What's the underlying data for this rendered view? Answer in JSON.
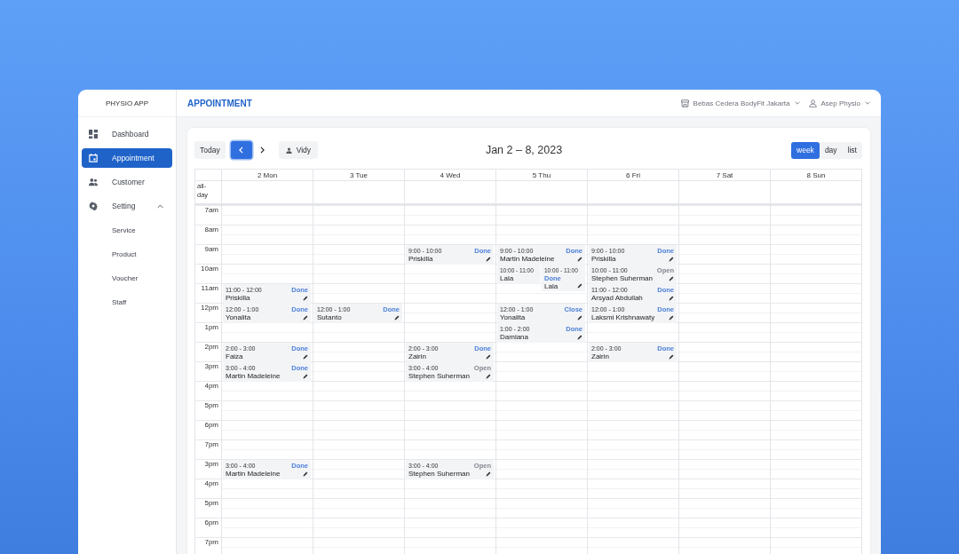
{
  "app": {
    "name": "PHYSIO APP"
  },
  "sidebar": {
    "items": [
      {
        "label": "Dashboard",
        "selected": false
      },
      {
        "label": "Appointment",
        "selected": true
      },
      {
        "label": "Customer",
        "selected": false
      },
      {
        "label": "Setting",
        "selected": false,
        "expanded": true,
        "children": [
          {
            "label": "Service",
            "selected": false
          },
          {
            "label": "Product",
            "selected": false
          },
          {
            "label": "Voucher",
            "selected": false
          },
          {
            "label": "Staff",
            "selected": false
          }
        ]
      }
    ]
  },
  "header": {
    "title": "APPOINTMENT",
    "location": "Bebas Cedera BodyFit Jakarta",
    "user": "Asep Physio"
  },
  "calendar": {
    "today_button": "Today",
    "prev_focused": true,
    "staff_filter": "Vidy",
    "range": "Jan 2 – 8, 2023",
    "views": [
      {
        "label": "week",
        "selected": true
      },
      {
        "label": "day",
        "selected": false
      },
      {
        "label": "list",
        "selected": false
      }
    ],
    "all_day_label": "all-day",
    "time_rows": [
      "7am",
      "8am",
      "9am",
      "10am",
      "11am",
      "12pm",
      "1pm",
      "2pm",
      "3pm",
      "4pm",
      "5pm",
      "6pm",
      "7pm",
      "3pm",
      "4pm",
      "5pm",
      "6pm",
      "7pm"
    ],
    "days": [
      {
        "label": "2 Mon",
        "cells": [
          {},
          {},
          {},
          {},
          {
            "events": [
              {
                "kind": "full",
                "time": "11:00 - 12:00",
                "name": "Priskilla",
                "status": "Done",
                "color": "#4a7fd8"
              }
            ]
          },
          {
            "events": [
              {
                "kind": "full",
                "time": "12:00 - 1:00",
                "name": "Yonalita",
                "status": "Done",
                "color": "#4a7fd8"
              }
            ]
          },
          {},
          {
            "events": [
              {
                "kind": "full",
                "time": "2:00 - 3:00",
                "name": "Faiza",
                "status": "Done",
                "color": "#4a7fd8"
              }
            ]
          },
          {
            "events": [
              {
                "kind": "full",
                "time": "3:00 - 4:00",
                "name": "Martin Madeleine",
                "status": "Done",
                "color": "#4a7fd8"
              }
            ]
          },
          {},
          {},
          {},
          {},
          {
            "events": [
              {
                "kind": "full",
                "time": "3:00 - 4:00",
                "name": "Martin Madeleine",
                "status": "Done",
                "color": "#4a7fd8"
              }
            ]
          },
          {},
          {},
          {},
          {}
        ]
      },
      {
        "label": "3 Tue",
        "cells": [
          {},
          {},
          {},
          {},
          {},
          {
            "events": [
              {
                "kind": "full",
                "time": "12:00 - 1:00",
                "name": "Sutanto",
                "status": "Done",
                "color": "#4a7fd8"
              }
            ]
          },
          {},
          {},
          {},
          {},
          {},
          {},
          {},
          {},
          {},
          {},
          {},
          {}
        ]
      },
      {
        "label": "4 Wed",
        "cells": [
          {},
          {},
          {
            "events": [
              {
                "kind": "full",
                "time": "9:00 - 10:00",
                "name": "Priskilla",
                "status": "Done",
                "color": "#4a7fd8"
              }
            ]
          },
          {},
          {},
          {},
          {},
          {
            "events": [
              {
                "kind": "full",
                "time": "2:00 - 3:00",
                "name": "Zairin",
                "status": "Done",
                "color": "#4a7fd8"
              }
            ]
          },
          {
            "events": [
              {
                "kind": "full",
                "time": "3:00 - 4:00",
                "name": "Stephen Suherman",
                "status": "Open",
                "color": "#80858e"
              }
            ]
          },
          {},
          {},
          {},
          {},
          {
            "events": [
              {
                "kind": "full",
                "time": "3:00 - 4:00",
                "name": "Stephen Suherman",
                "status": "Open",
                "color": "#80858e"
              }
            ]
          },
          {},
          {},
          {},
          {}
        ]
      },
      {
        "label": "5 Thu",
        "cells": [
          {},
          {},
          {
            "events": [
              {
                "kind": "full",
                "time": "9:00 - 10:00",
                "name": "Martin Madeleine",
                "status": "Done",
                "color": "#4a7fd8"
              }
            ]
          },
          {
            "events": [
              {
                "kind": "left",
                "time": "10:00 - 11:00",
                "name": "Lala"
              },
              {
                "kind": "right",
                "time": "10:00 - 11:00",
                "name": "Lala",
                "status": "Done",
                "color": "#4a7fd8"
              }
            ]
          },
          {},
          {
            "events": [
              {
                "kind": "full",
                "time": "12:00 - 1:00",
                "name": "Yonalita",
                "status": "Close",
                "color": "#4a7fd8"
              }
            ]
          },
          {
            "events": [
              {
                "kind": "full",
                "time": "1:00 - 2:00",
                "name": "Damiana",
                "status": "Done",
                "color": "#4a7fd8"
              }
            ]
          },
          {},
          {},
          {},
          {},
          {},
          {},
          {},
          {},
          {},
          {},
          {}
        ]
      },
      {
        "label": "6 Fri",
        "cells": [
          {},
          {},
          {
            "events": [
              {
                "kind": "full",
                "time": "9:00 - 10:00",
                "name": "Priskilla",
                "status": "Done",
                "color": "#4a7fd8"
              }
            ]
          },
          {
            "events": [
              {
                "kind": "full",
                "time": "10:00 - 11:00",
                "name": "Stephen Suherman",
                "status": "Open",
                "color": "#80858e"
              }
            ]
          },
          {
            "events": [
              {
                "kind": "full",
                "time": "11:00 - 12:00",
                "name": "Arsyad Abdullah",
                "status": "Done",
                "color": "#4a7fd8"
              }
            ]
          },
          {
            "events": [
              {
                "kind": "full",
                "time": "12:00 - 1:00",
                "name": "Laksmi Krishnawaty",
                "status": "Done",
                "color": "#4a7fd8"
              }
            ]
          },
          {},
          {
            "events": [
              {
                "kind": "full",
                "time": "2:00 - 3:00",
                "name": "Zairin",
                "status": "Done",
                "color": "#4a7fd8"
              }
            ]
          },
          {},
          {},
          {},
          {},
          {},
          {},
          {},
          {},
          {},
          {}
        ]
      },
      {
        "label": "7 Sat",
        "cells": [
          {},
          {},
          {},
          {},
          {},
          {},
          {},
          {},
          {},
          {},
          {},
          {},
          {},
          {},
          {},
          {},
          {},
          {}
        ]
      },
      {
        "label": "8 Sun",
        "cells": [
          {},
          {},
          {},
          {},
          {},
          {},
          {},
          {},
          {},
          {},
          {},
          {},
          {},
          {},
          {},
          {},
          {},
          {}
        ]
      }
    ]
  }
}
